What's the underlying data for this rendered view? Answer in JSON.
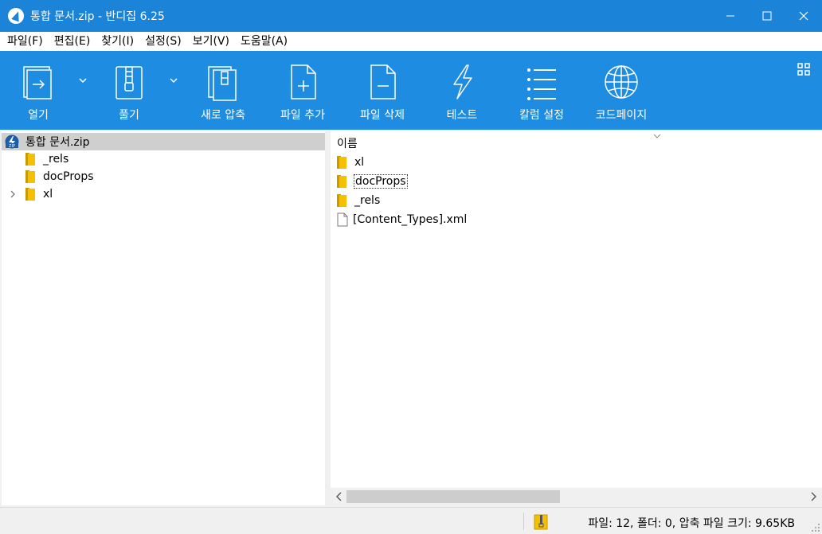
{
  "window": {
    "title": "통합 문서.zip - 반디집 6.25"
  },
  "menu": [
    "파일(F)",
    "편집(E)",
    "찾기(I)",
    "설정(S)",
    "보기(V)",
    "도움말(A)"
  ],
  "toolbar": {
    "open": "열기",
    "extract": "풀기",
    "new_archive": "새로 압축",
    "add_file": "파일 추가",
    "delete_file": "파일 삭제",
    "test": "테스트",
    "column_settings": "칼럼 설정",
    "codepage": "코드페이지"
  },
  "tree": {
    "root": "통합 문서.zip",
    "items": [
      "_rels",
      "docProps",
      "xl"
    ]
  },
  "list": {
    "column_name": "이름",
    "items": [
      "xl",
      "docProps",
      "_rels",
      "[Content_Types].xml"
    ]
  },
  "status": {
    "text": "파일: 12, 폴더: 0, 압축 파일 크기: 9.65KB"
  },
  "colors": {
    "titlebar": "#1b83d8",
    "toolbar": "#1e8ce0",
    "folder": "#f5c000"
  }
}
